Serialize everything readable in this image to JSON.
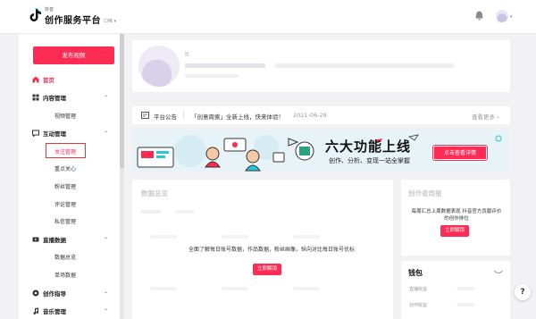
{
  "app": {
    "logo_small": "抖音",
    "logo_text": "创作服务平台",
    "account_switch": "口味",
    "account_caret": "▾",
    "avatar_caret": "▾"
  },
  "sidebar": {
    "publish_label": "发布视频",
    "items": [
      {
        "label": "首页"
      },
      {
        "label": "内容管理",
        "caret": "⌃"
      },
      {
        "label": "视频管理"
      },
      {
        "label": "互动管理",
        "caret": "⌃"
      },
      {
        "label": "关注管理"
      },
      {
        "label": "重点关心"
      },
      {
        "label": "粉丝管理"
      },
      {
        "label": "评论管理"
      },
      {
        "label": "私信管理"
      },
      {
        "label": "直播数据",
        "caret": "⌃"
      },
      {
        "label": "数据总览"
      },
      {
        "label": "单场数据"
      },
      {
        "label": "创作指导",
        "caret": "⌄"
      },
      {
        "label": "音乐管理",
        "caret": "⌃"
      }
    ]
  },
  "profile": {
    "name": "lt"
  },
  "notice": {
    "label": "平台公告",
    "text": "「创意周索」全新上线，快来体验！",
    "date": "2021-06-28",
    "more": "查看更多 ›"
  },
  "banner": {
    "title": "六大功能上线",
    "subtitle": "创作、分析、变现一站全掌握",
    "button": "点击查看详情"
  },
  "data_overview": {
    "title": "数据总览",
    "overlay_text": "全面了解每日账号数据，作品数据，粉丝画像，纵向对比每日账号优标",
    "unlock": "立即解锁"
  },
  "weekly_report": {
    "title": "创作者周报",
    "desc": "每周汇总上周数据表现 抖音官方贡献评价的创作排位",
    "unlock": "立即解锁"
  },
  "wallet": {
    "title": "钱包",
    "rows": [
      "直播收益",
      "创作收益"
    ]
  },
  "help": {
    "label": "?"
  }
}
